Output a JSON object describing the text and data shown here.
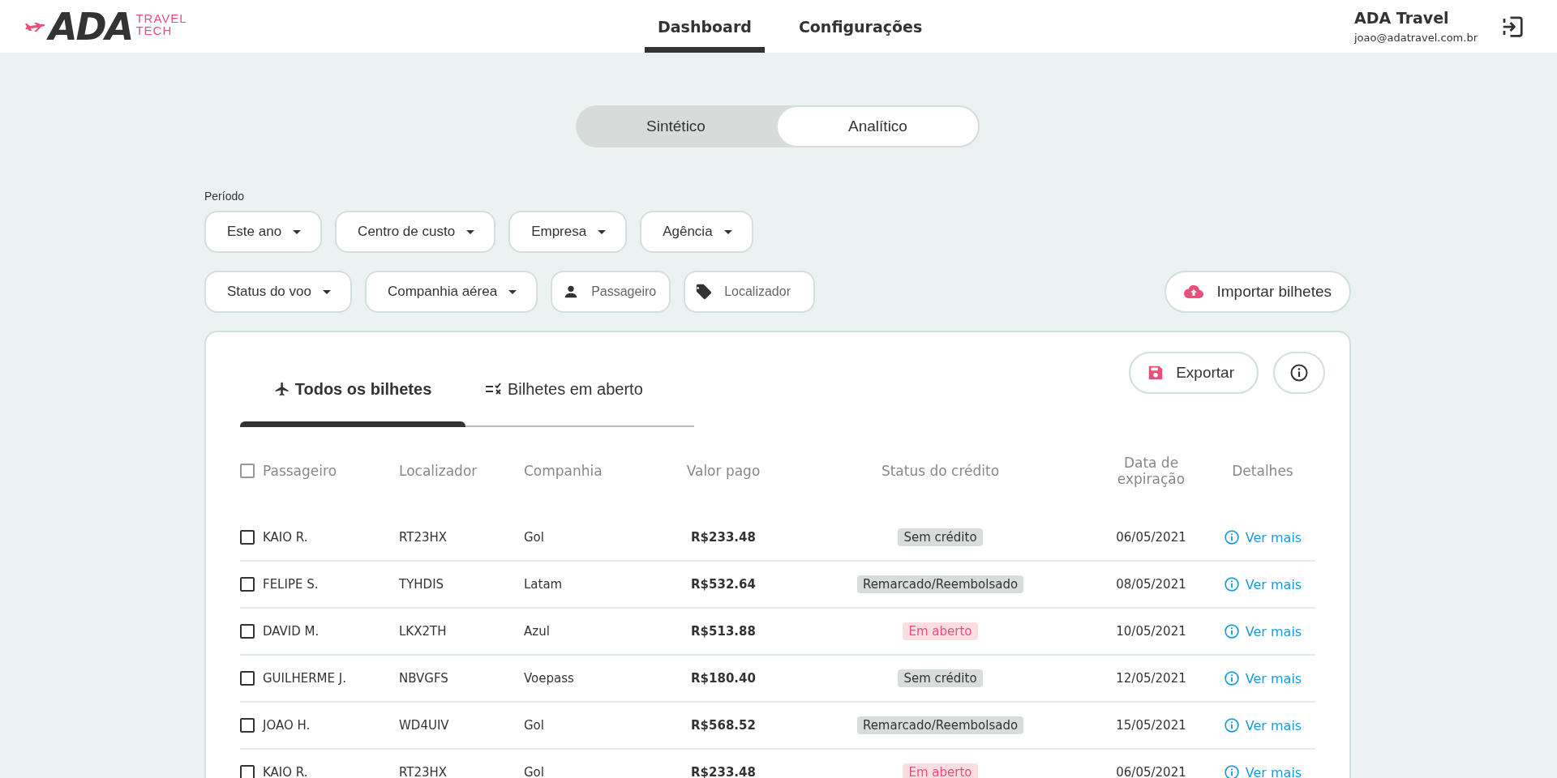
{
  "header": {
    "logo": {
      "main": "ADA",
      "sub_1": "TRAVEL",
      "sub_2": "TECH"
    },
    "nav": [
      {
        "label": "Dashboard",
        "selected": true
      },
      {
        "label": "Configurações",
        "selected": false
      }
    ],
    "user": {
      "name": "ADA Travel",
      "email": "joao@adatravel.com.br"
    }
  },
  "view_toggle": [
    {
      "label": "Sintético",
      "selected": false
    },
    {
      "label": "Analítico",
      "selected": true
    }
  ],
  "filters": {
    "period_label": "Período",
    "row_1": [
      {
        "kind": "dropdown",
        "label": "Este ano"
      },
      {
        "kind": "dropdown",
        "label": "Centro de custo"
      },
      {
        "kind": "dropdown",
        "label": "Empresa"
      },
      {
        "kind": "dropdown",
        "label": "Agência"
      }
    ],
    "row_2": [
      {
        "kind": "dropdown",
        "label": "Status do voo"
      },
      {
        "kind": "dropdown",
        "label": "Companhia aérea"
      },
      {
        "kind": "person",
        "placeholder": "Passageiro"
      },
      {
        "kind": "tag",
        "placeholder": "Localizador"
      }
    ],
    "import_button": "Importar bilhetes"
  },
  "card": {
    "tabs": [
      {
        "label": "Todos os bilhetes",
        "kind": "plane",
        "selected": true
      },
      {
        "label": "Bilhetes em aberto",
        "kind": "checklist",
        "selected": false
      }
    ],
    "export_button": "Exportar",
    "table": {
      "columns": [
        "Passageiro",
        "Localizador",
        "Companhia",
        "Valor pago",
        "Status do crédito",
        "Data de expiração",
        "Detalhes"
      ],
      "header_checked": false,
      "rows": [
        {
          "checked": false,
          "passenger": "KAIO R.",
          "locator": "RT23HX",
          "airline": "Gol",
          "paid": "R$233.48",
          "status": {
            "label": "Sem crédito",
            "kind": "neutral"
          },
          "expiry": "06/05/2021",
          "details": "Ver mais"
        },
        {
          "checked": false,
          "passenger": "FELIPE S.",
          "locator": "TYHDIS",
          "airline": "Latam",
          "paid": "R$532.64",
          "status": {
            "label": "Remarcado/Reembolsado",
            "kind": "neutral"
          },
          "expiry": "08/05/2021",
          "details": "Ver mais"
        },
        {
          "checked": false,
          "passenger": "DAVID M.",
          "locator": "LKX2TH",
          "airline": "Azul",
          "paid": "R$513.88",
          "status": {
            "label": "Em aberto",
            "kind": "open"
          },
          "expiry": "10/05/2021",
          "details": "Ver mais"
        },
        {
          "checked": false,
          "passenger": "GUILHERME J.",
          "locator": "NBVGFS",
          "airline": "Voepass",
          "paid": "R$180.40",
          "status": {
            "label": "Sem crédito",
            "kind": "neutral"
          },
          "expiry": "12/05/2021",
          "details": "Ver mais"
        },
        {
          "checked": false,
          "passenger": "JOAO H.",
          "locator": "WD4UIV",
          "airline": "Gol",
          "paid": "R$568.52",
          "status": {
            "label": "Remarcado/Reembolsado",
            "kind": "neutral"
          },
          "expiry": "15/05/2021",
          "details": "Ver mais"
        },
        {
          "checked": false,
          "passenger": "KAIO R.",
          "locator": "RT23HX",
          "airline": "Gol",
          "paid": "R$233.48",
          "status": {
            "label": "Em aberto",
            "kind": "open"
          },
          "expiry": "06/05/2021",
          "details": "Ver mais"
        }
      ]
    }
  }
}
